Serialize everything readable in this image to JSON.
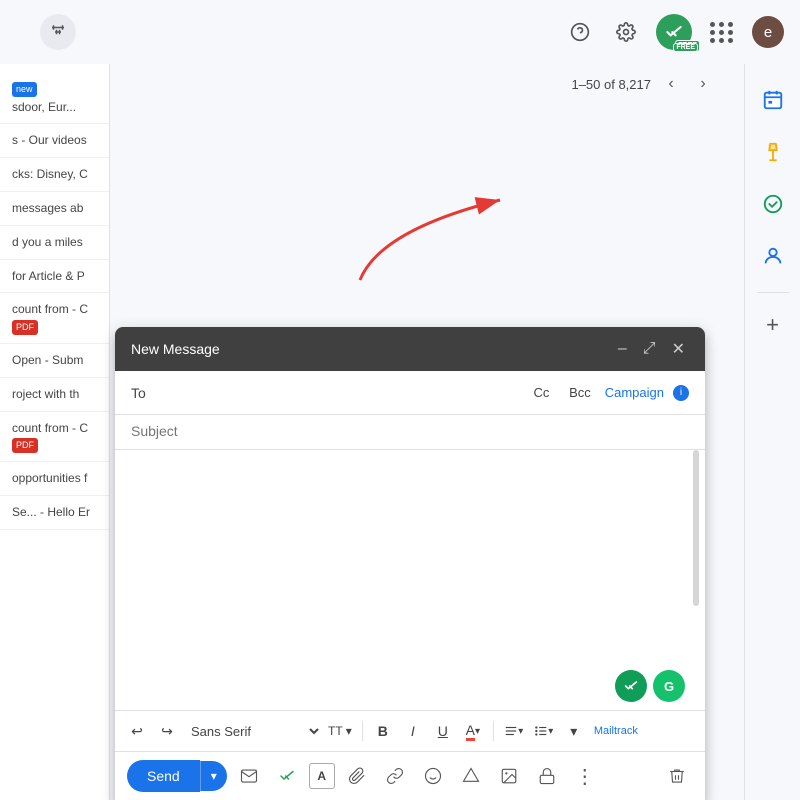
{
  "topbar": {
    "filter_icon": "⇅",
    "help_icon": "?",
    "settings_icon": "⚙",
    "apps_icon": "⋮⋮⋮",
    "avatar_letter": "e"
  },
  "pagination": {
    "range": "1–50 of 8,217",
    "prev": "‹",
    "next": "›"
  },
  "email_list": {
    "items": [
      {
        "label": "Se... - Our videos",
        "unread": false
      },
      {
        "label": "cks: Disney, C",
        "unread": false
      },
      {
        "label": "messages ab",
        "unread": false
      },
      {
        "label": "d you a miles",
        "unread": false
      },
      {
        "label": "for Article & P",
        "unread": false
      },
      {
        "label": "count from - C",
        "unread": false
      },
      {
        "label": "Open - Subm",
        "unread": false
      },
      {
        "label": "roject with th",
        "unread": false
      },
      {
        "label": "count from - C",
        "unread": false
      },
      {
        "label": "opportunities f",
        "unread": false
      },
      {
        "label": "Se... - Hello Er",
        "unread": false
      }
    ]
  },
  "right_sidebar": {
    "icons": [
      {
        "name": "calendar",
        "symbol": "📅"
      },
      {
        "name": "keep",
        "symbol": "💛"
      },
      {
        "name": "tasks",
        "symbol": "✅"
      },
      {
        "name": "contacts",
        "symbol": "👤"
      }
    ],
    "add_label": "+"
  },
  "compose": {
    "title": "New Message",
    "minimize_label": "–",
    "maximize_label": "⤢",
    "close_label": "✕",
    "to_label": "To",
    "cc_label": "Cc",
    "bcc_label": "Bcc",
    "campaign_label": "Campaign",
    "info_label": "i",
    "subject_placeholder": "Subject",
    "toolbar": {
      "undo": "↩",
      "redo": "↪",
      "font_name": "Sans Serif",
      "text_size_icon": "TT",
      "bold": "B",
      "italic": "I",
      "underline": "U",
      "text_color": "A",
      "align": "≡",
      "list": "☰",
      "more": "▾"
    },
    "mailtrack_text": "Mailtrack",
    "send_label": "Send",
    "send_dropdown": "▾",
    "action_icons": {
      "mailtrack": "✉",
      "mailtrack2": "✉",
      "format_text": "A",
      "attach": "📎",
      "link": "🔗",
      "emoji": "😊",
      "drive": "△",
      "photo": "🖼",
      "lock": "🔒",
      "more": "⋮",
      "trash": "🗑"
    }
  }
}
